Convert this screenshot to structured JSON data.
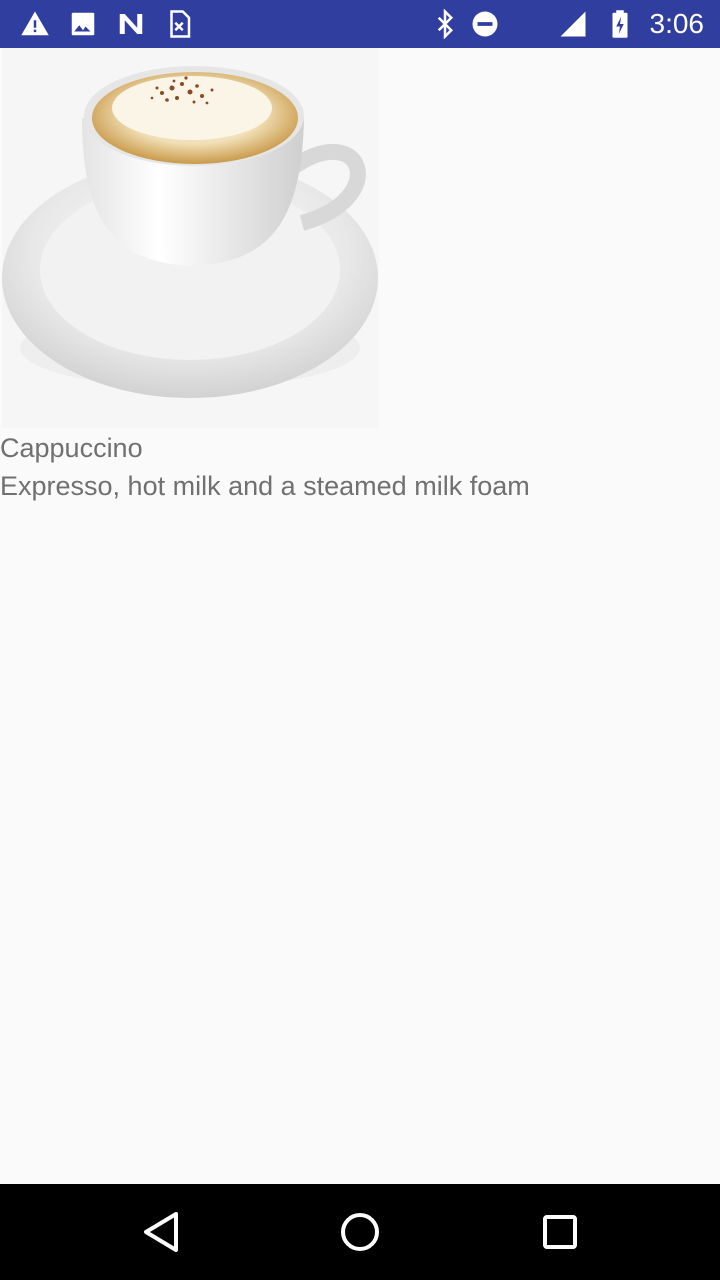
{
  "status_bar": {
    "time": "3:06",
    "left_icons": [
      "warning-icon",
      "image-icon",
      "n-logo-icon",
      "sim-card-icon"
    ],
    "right_icons": [
      "bluetooth-icon",
      "do-not-disturb-icon",
      "signal-icon",
      "battery-charging-icon"
    ],
    "background_color": "#303f9f"
  },
  "product": {
    "image_icon": "cappuccino-cup-image",
    "name": "Cappuccino",
    "description": "Expresso, hot milk and a steamed milk foam"
  },
  "nav_bar": {
    "buttons": [
      "back-icon",
      "home-icon",
      "recents-icon"
    ]
  }
}
